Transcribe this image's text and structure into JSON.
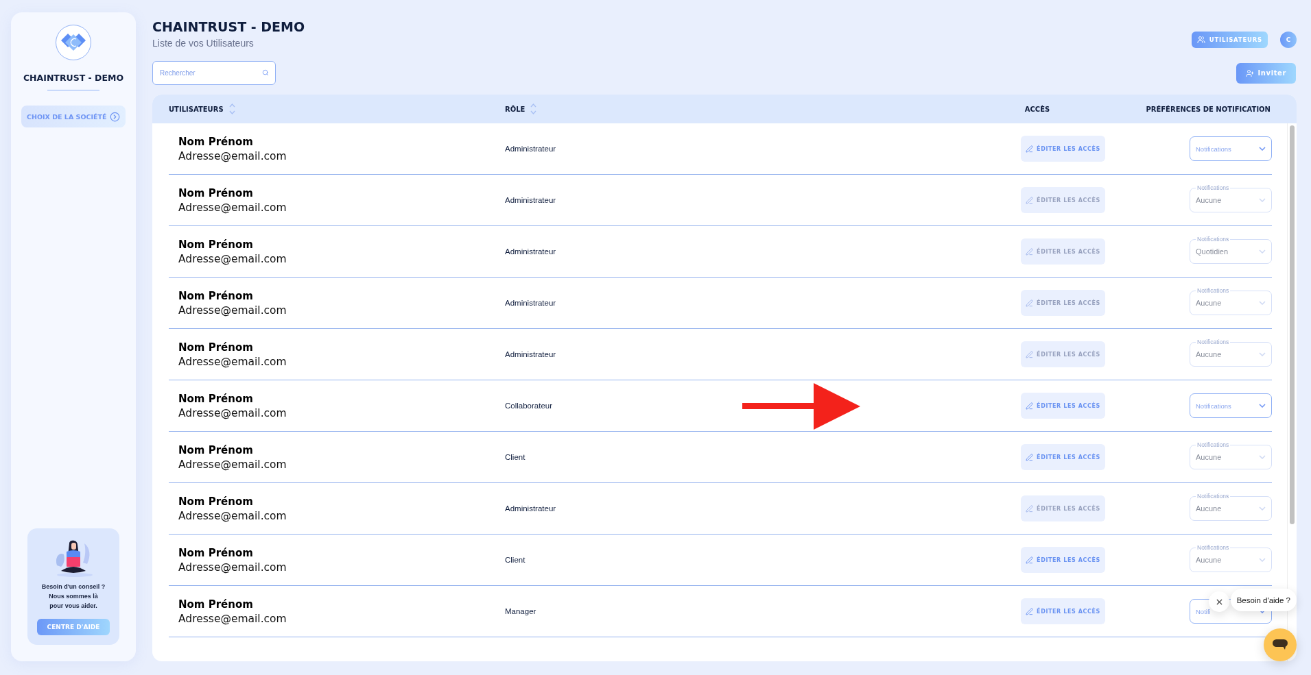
{
  "sidebar": {
    "company": "CHAINTRUST - DEMO",
    "menu": [
      {
        "label": "CHOIX DE LA SOCIÉTÉ",
        "selected": true
      }
    ],
    "help_card": {
      "lines": [
        "Besoin d'un conseil ?",
        "Nous sommes là",
        "pour vous aider."
      ],
      "button": "CENTRE D'AIDE"
    }
  },
  "header": {
    "title": "CHAINTRUST - DEMO",
    "subtitle": "Liste de vos Utilisateurs",
    "users_button": "UTILISATEURS",
    "avatar": "C"
  },
  "search": {
    "placeholder": "Rechercher"
  },
  "invite_button": "Inviter",
  "table": {
    "columns": [
      {
        "label": "UTILISATEURS",
        "sortable": true
      },
      {
        "label": "RÔLE",
        "sortable": true
      },
      {
        "label": "ACCÈS",
        "sortable": false
      },
      {
        "label": "PRÉFÉRENCES DE NOTIFICATION",
        "sortable": false
      }
    ],
    "rows": [
      {
        "name": "Nom Prénom",
        "email": "Adresse@email.com",
        "role": "Administrateur",
        "edit": {
          "label": "ÉDITER LES ACCÈS",
          "disabled": false
        },
        "notifications": {
          "label": "Notifications",
          "disabled": false
        }
      },
      {
        "name": "Nom Prénom",
        "email": "Adresse@email.com",
        "role": "Administrateur",
        "edit": {
          "label": "ÉDITER LES ACCÈS",
          "disabled": true
        },
        "notifications": {
          "label": "Notifications",
          "value": "Aucune",
          "disabled": true
        }
      },
      {
        "name": "Nom Prénom",
        "email": "Adresse@email.com",
        "role": "Administrateur",
        "edit": {
          "label": "ÉDITER LES ACCÈS",
          "disabled": true
        },
        "notifications": {
          "label": "Notifications",
          "value": "Quotidien",
          "disabled": true
        }
      },
      {
        "name": "Nom Prénom",
        "email": "Adresse@email.com",
        "role": "Administrateur",
        "edit": {
          "label": "ÉDITER LES ACCÈS",
          "disabled": true
        },
        "notifications": {
          "label": "Notifications",
          "value": "Aucune",
          "disabled": true
        }
      },
      {
        "name": "Nom Prénom",
        "email": "Adresse@email.com",
        "role": "Administrateur",
        "edit": {
          "label": "ÉDITER LES ACCÈS",
          "disabled": true
        },
        "notifications": {
          "label": "Notifications",
          "value": "Aucune",
          "disabled": true
        }
      },
      {
        "name": "Nom Prénom",
        "email": "Adresse@email.com",
        "role": "Collaborateur",
        "edit": {
          "label": "ÉDITER LES ACCÈS",
          "disabled": false
        },
        "notifications": {
          "label": "Notifications",
          "disabled": false
        },
        "annotation": {
          "kind": "arrow"
        }
      },
      {
        "name": "Nom Prénom",
        "email": "Adresse@email.com",
        "role": "Client",
        "edit": {
          "label": "ÉDITER LES ACCÈS",
          "disabled": false
        },
        "notifications": {
          "label": "Notifications",
          "value": "Aucune",
          "disabled": true
        }
      },
      {
        "name": "Nom Prénom",
        "email": "Adresse@email.com",
        "role": "Administrateur",
        "edit": {
          "label": "ÉDITER LES ACCÈS",
          "disabled": true
        },
        "notifications": {
          "label": "Notifications",
          "value": "Aucune",
          "disabled": true
        }
      },
      {
        "name": "Nom Prénom",
        "email": "Adresse@email.com",
        "role": "Client",
        "edit": {
          "label": "ÉDITER LES ACCÈS",
          "disabled": false
        },
        "notifications": {
          "label": "Notifications",
          "value": "Aucune",
          "disabled": true
        }
      },
      {
        "name": "Nom Prénom",
        "email": "Adresse@email.com",
        "role": "Manager",
        "edit": {
          "label": "ÉDITER LES ACCÈS",
          "disabled": false
        },
        "notifications": {
          "label": "Notifi",
          "disabled": false
        }
      }
    ]
  },
  "chat": {
    "message": "Besoin d'aide ?"
  }
}
